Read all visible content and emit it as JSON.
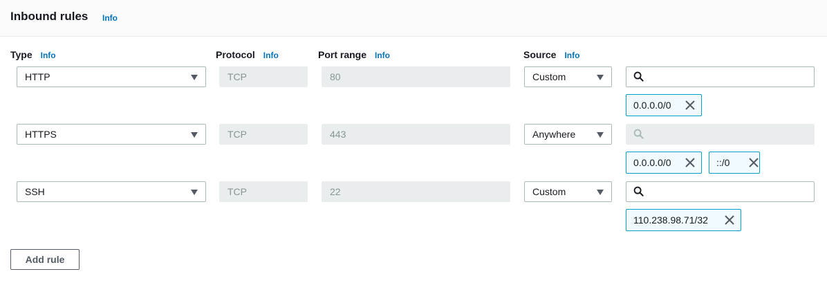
{
  "header": {
    "title": "Inbound rules",
    "info": "Info"
  },
  "columns": {
    "type": {
      "label": "Type",
      "info": "Info"
    },
    "protocol": {
      "label": "Protocol",
      "info": "Info"
    },
    "port": {
      "label": "Port range",
      "info": "Info"
    },
    "source": {
      "label": "Source",
      "info": "Info"
    }
  },
  "rules": [
    {
      "type": "HTTP",
      "protocol": "TCP",
      "port": "80",
      "source": "Custom",
      "tokens": [
        "0.0.0.0/0"
      ]
    },
    {
      "type": "HTTPS",
      "protocol": "TCP",
      "port": "443",
      "source": "Anywhere",
      "tokens": [
        "0.0.0.0/0",
        "::/0"
      ]
    },
    {
      "type": "SSH",
      "protocol": "TCP",
      "port": "22",
      "source": "Custom",
      "tokens": [
        "110.238.98.71/32"
      ]
    }
  ],
  "add_rule_label": "Add rule"
}
